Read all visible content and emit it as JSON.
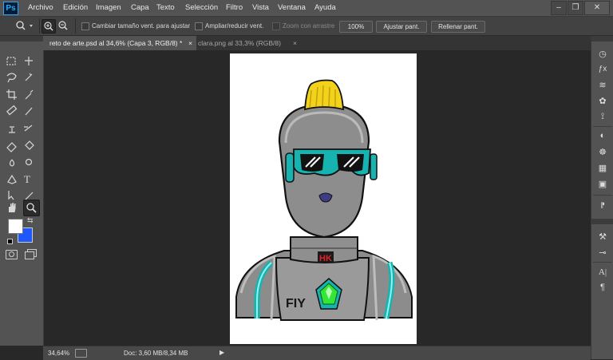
{
  "app": {
    "logo": "Ps"
  },
  "menu": [
    "Archivo",
    "Edición",
    "Imagen",
    "Capa",
    "Texto",
    "Selección",
    "Filtro",
    "Vista",
    "Ventana",
    "Ayuda"
  ],
  "window_controls": [
    "–",
    "❐",
    "✕"
  ],
  "options": {
    "resize_windows": "Cambiar tamaño vent. para ajustar",
    "zoom_all": "Ampliar/reducir vent.",
    "scrubby_zoom": "Zoom con arrastre",
    "btn_100": "100%",
    "btn_fit": "Ajustar pant.",
    "btn_fill": "Rellenar pant."
  },
  "tabs": [
    {
      "label": "reto de arte.psd al 34,6% (Capa 3, RGB/8) *",
      "close": "×",
      "active": true
    },
    {
      "label": "clara.png al 33,3% (RGB/8)",
      "close": "×",
      "active": false
    }
  ],
  "status": {
    "zoom": "34,64%",
    "doc": "Doc: 3,60 MB/8,34 MB",
    "arrow": "▶"
  },
  "artwork": {
    "chest_text": "FIY",
    "badge_text": "HK"
  },
  "colors": {
    "foreground": "#ffffff",
    "background": "#1f57ff",
    "accent_teal": "#16b3b0",
    "hair": "#f2d21a",
    "gem": "#35e63a",
    "badge": "#e0232a"
  }
}
